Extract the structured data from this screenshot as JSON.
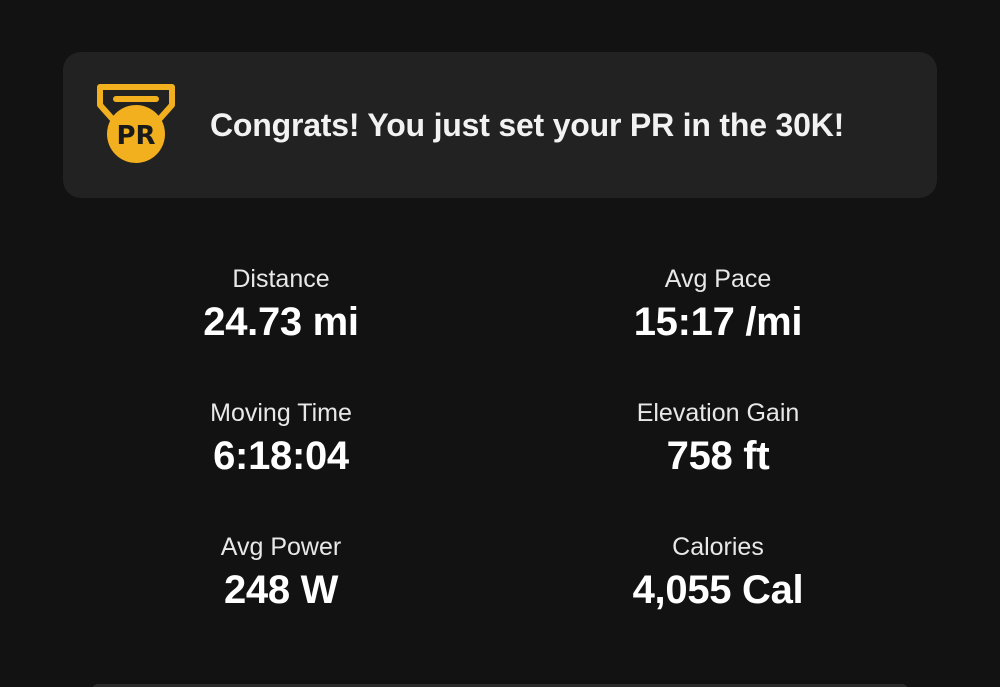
{
  "pr_banner": {
    "badge_icon": "pr-medal-icon",
    "badge_text": "PR",
    "badge_color": "#F2B01E",
    "message": "Congrats! You just set your PR in the 30K!"
  },
  "stats": [
    {
      "label": "Distance",
      "value": "24.73 mi"
    },
    {
      "label": "Avg Pace",
      "value": "15:17 /mi"
    },
    {
      "label": "Moving Time",
      "value": "6:18:04"
    },
    {
      "label": "Elevation Gain",
      "value": "758 ft"
    },
    {
      "label": "Avg Power",
      "value": "248 W"
    },
    {
      "label": "Calories",
      "value": "4,055 Cal"
    }
  ],
  "colors": {
    "background": "#121212",
    "card": "#222222",
    "text": "#FFFFFF"
  }
}
